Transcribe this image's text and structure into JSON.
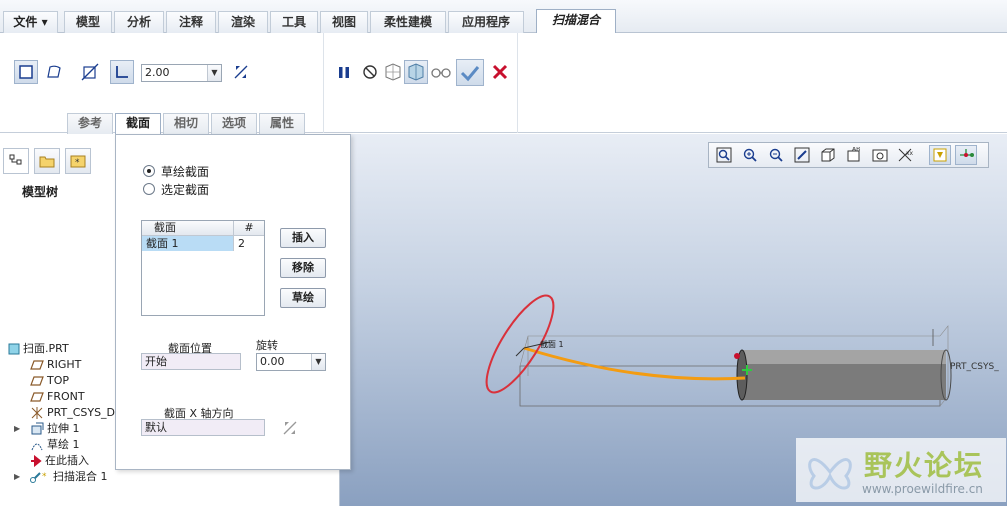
{
  "menubar": {
    "file": "文件 ▾",
    "tabs": [
      "模型",
      "分析",
      "注释",
      "渲染",
      "工具",
      "视图",
      "柔性建模",
      "应用程序"
    ],
    "active_tab": "扫描混合"
  },
  "ribbon": {
    "combo_value": "2.00",
    "sub_tabs": [
      "参考",
      "截面",
      "相切",
      "选项",
      "属性"
    ],
    "active_sub_tab": "截面"
  },
  "panel": {
    "radio_sketch": "草绘截面",
    "radio_select": "选定截面",
    "table_header": [
      "截面",
      "#"
    ],
    "table_rows": [
      {
        "name": "截面 1",
        "num": "2"
      }
    ],
    "btn_insert": "插入",
    "btn_remove": "移除",
    "btn_sketch": "草绘",
    "label_position": "截面位置",
    "value_position": "开始",
    "label_rotation": "旋转",
    "value_rotation": "0.00",
    "label_xaxis": "截面 X 轴方向",
    "value_xaxis": "默认"
  },
  "tree": {
    "title": "模型树",
    "items": [
      "扫面.PRT",
      "RIGHT",
      "TOP",
      "FRONT",
      "PRT_CSYS_D",
      "拉伸 1",
      "草绘 1",
      "在此插入",
      "扫描混合 1"
    ]
  },
  "viewport": {
    "label_csys": "PRT_CSYS_",
    "label_section": "截面 1"
  },
  "watermark": {
    "brand": "野火论坛",
    "url": "www.proewildfire.cn"
  },
  "colors": {
    "accent_blue": "#1a3d8f",
    "confirm_check": "#5b8bc4",
    "cancel_red": "#c8102e",
    "trajectory": "#f39c12",
    "section_ellipse": "#d9313b"
  }
}
